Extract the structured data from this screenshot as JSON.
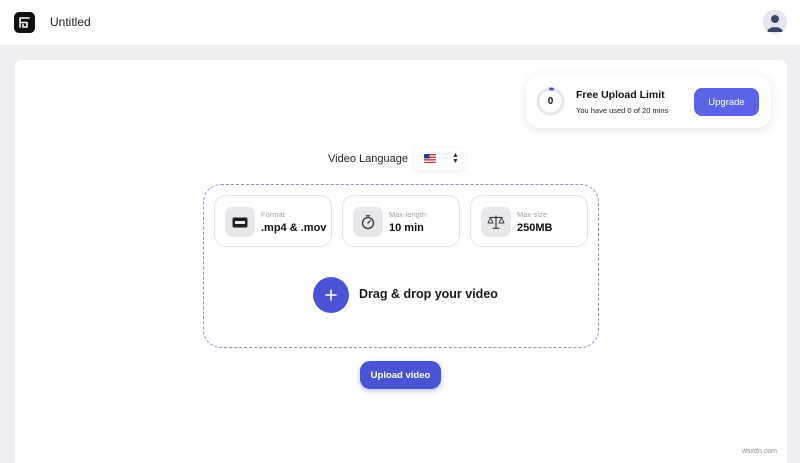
{
  "app": {
    "title": "Untitled",
    "logo_icon": "app-logo-icon",
    "avatar_icon": "user-avatar-icon"
  },
  "limit": {
    "count": "0",
    "progress": 0,
    "title": "Free Upload Limit",
    "subtitle": "You have used 0 of 20 mins",
    "upgrade_label": "Upgrade"
  },
  "language": {
    "label": "Video Language",
    "selected_flag": "us-flag-icon"
  },
  "specs": [
    {
      "icon": "film-icon",
      "label": "Format",
      "value": ".mp4 & .mov"
    },
    {
      "icon": "stopwatch-icon",
      "label": "Max-length",
      "value": "10 min"
    },
    {
      "icon": "scale-icon",
      "label": "Max-size",
      "value": "250MB"
    }
  ],
  "dropzone": {
    "text": "Drag & drop your video",
    "icon": "plus-icon"
  },
  "upload_label": "Upload video",
  "watermark": "wsxdn.com",
  "colors": {
    "accent": "#4a53d6",
    "upgrade": "#5b64e6",
    "page_bg": "#eeeff3"
  }
}
